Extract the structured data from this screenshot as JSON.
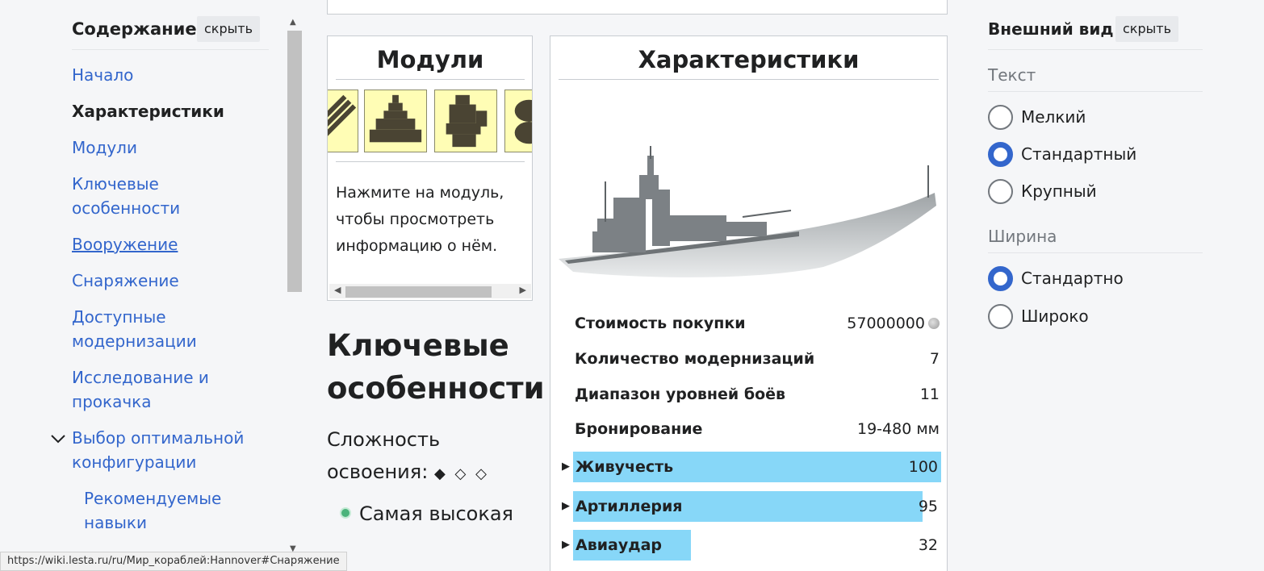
{
  "toc": {
    "title": "Содержание",
    "hide_label": "скрыть",
    "items": [
      {
        "label": "Начало"
      },
      {
        "label": "Характеристики"
      },
      {
        "label": "Модули"
      },
      {
        "label": "Ключевые особенности"
      },
      {
        "label": "Вооружение"
      },
      {
        "label": "Снаряжение"
      },
      {
        "label": "Доступные модернизации"
      },
      {
        "label": "Исследование и прокачка"
      },
      {
        "label": "Выбор оптимальной конфигурации"
      },
      {
        "label": "Рекомендуемые навыки"
      }
    ]
  },
  "modules": {
    "title": "Модули",
    "hint": "Нажмите на модуль, чтобы просмотреть информацию о нём."
  },
  "key_features": {
    "title": "Ключевые особенности",
    "difficulty_label": "Сложность освоения:",
    "difficulty_marks": "◆ ◇ ◇",
    "feature_1": "Самая высокая"
  },
  "characteristics": {
    "title": "Характеристики",
    "rows": [
      {
        "label": "Стоимость покупки",
        "value": "57000000"
      },
      {
        "label": "Количество модернизаций",
        "value": "7"
      },
      {
        "label": "Диапазон уровней боёв",
        "value": "11"
      },
      {
        "label": "Бронирование",
        "value": "19-480 мм"
      }
    ],
    "bars": [
      {
        "label": "Живучесть",
        "value": "100",
        "fill": 1.0
      },
      {
        "label": "Артиллерия",
        "value": "95",
        "fill": 0.95
      },
      {
        "label": "Авиаудар",
        "value": "32",
        "fill": 0.32
      }
    ],
    "bar_color": "#87d7f8"
  },
  "appearance": {
    "title": "Внешний вид",
    "hide_label": "скрыть",
    "text_section": "Текст",
    "text_options": [
      {
        "label": "Мелкий",
        "selected": false
      },
      {
        "label": "Стандартный",
        "selected": true
      },
      {
        "label": "Крупный",
        "selected": false
      }
    ],
    "width_section": "Ширина",
    "width_options": [
      {
        "label": "Стандартно",
        "selected": true
      },
      {
        "label": "Широко",
        "selected": false
      }
    ],
    "accent_color": "#3366cc"
  },
  "status_bar": {
    "url": "https://wiki.lesta.ru/ru/Мир_кораблей:Hannover#Снаряжение"
  }
}
